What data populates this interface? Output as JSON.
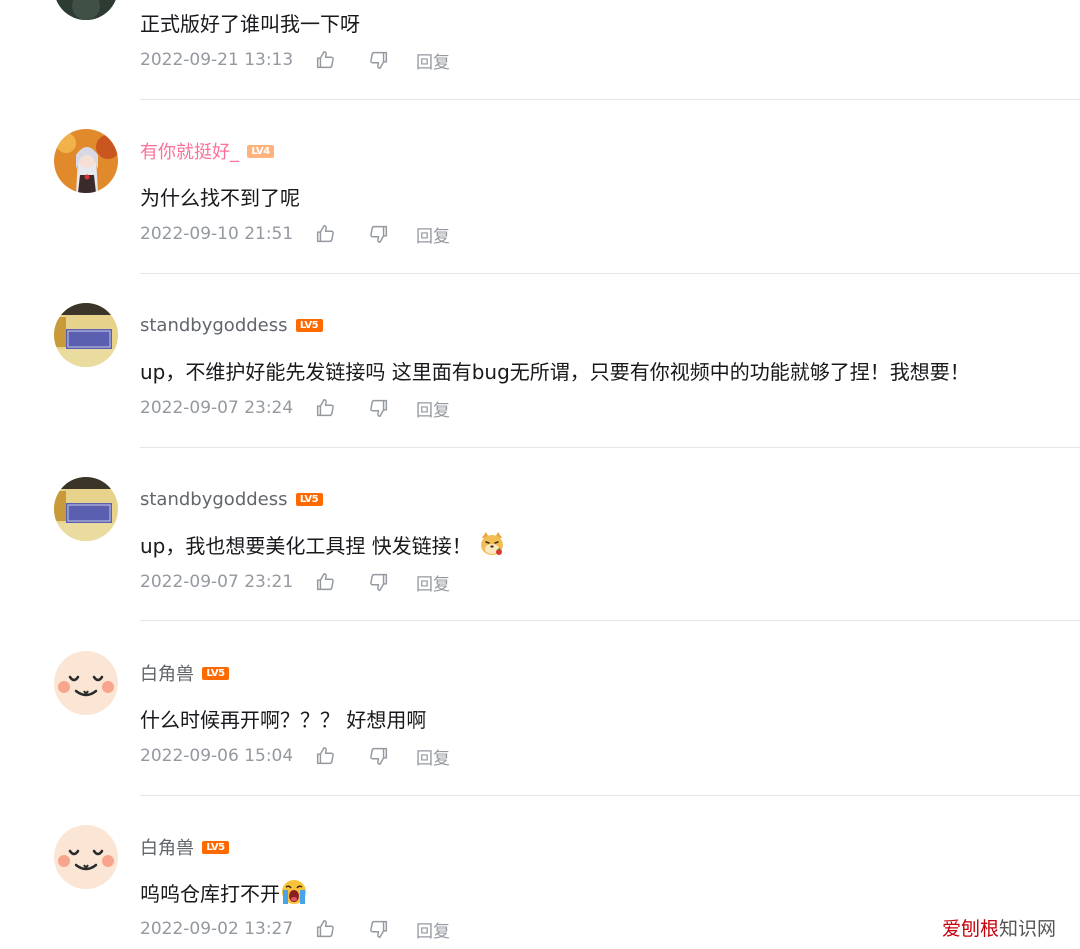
{
  "reply_label": "回复",
  "comments": [
    {
      "username": "",
      "level": "",
      "content": "正式版好了谁叫我一下呀",
      "time": "2022-09-21 13:13"
    },
    {
      "username": "有你就挺好_",
      "level": "LV4",
      "content": "为什么找不到了呢",
      "time": "2022-09-10 21:51"
    },
    {
      "username": "standbygoddess",
      "level": "LV5",
      "content": "up，不维护好能先发链接吗 这里面有bug无所谓，只要有你视频中的功能就够了捏！我想要！",
      "time": "2022-09-07 23:24"
    },
    {
      "username": "standbygoddess",
      "level": "LV5",
      "content": "up，我也想要美化工具捏 快发链接！",
      "time": "2022-09-07 23:21",
      "emoji": "dog-emoji"
    },
    {
      "username": "白角兽",
      "level": "LV5",
      "content": "什么时候再开啊？？？ 好想用啊",
      "time": "2022-09-06 15:04"
    },
    {
      "username": "白角兽",
      "level": "LV5",
      "content": "呜呜仓库打不开",
      "time": "2022-09-02 13:27",
      "emoji": "crying-emoji"
    }
  ],
  "watermark": {
    "brand": "爱刨根",
    "suffix": "知识网"
  },
  "colors": {
    "username": "#61666d",
    "vip_username": "#fb7299",
    "level_lv5": "#ff6a00",
    "level_lv4": "#ffb37c",
    "meta": "#9499a0",
    "divider": "#e3e5e7"
  }
}
